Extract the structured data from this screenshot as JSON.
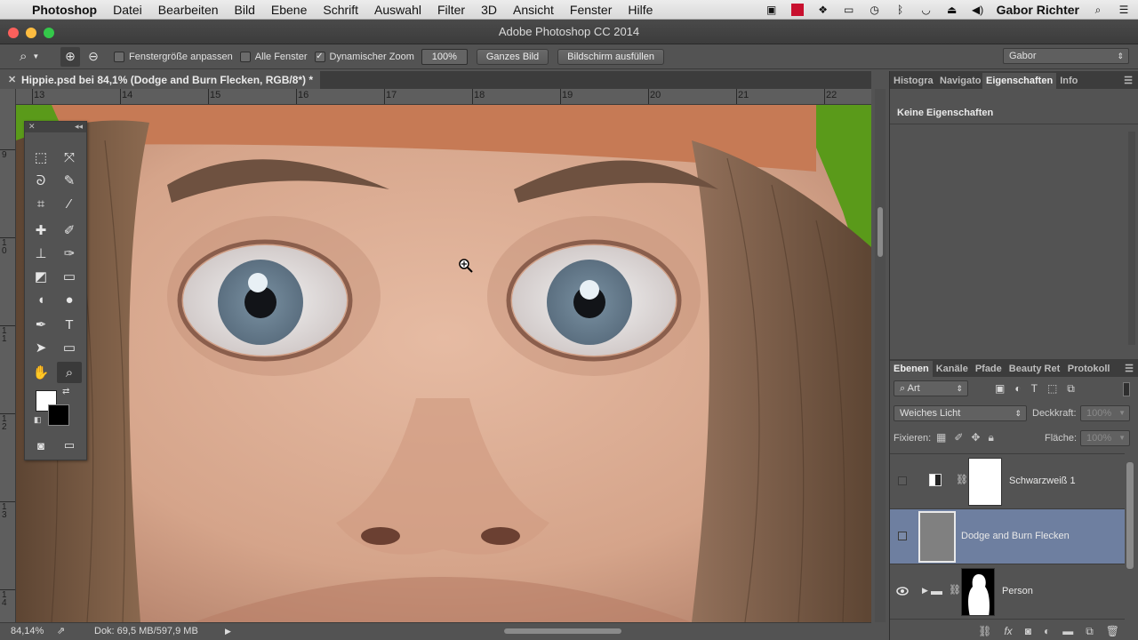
{
  "menubar": {
    "app_name": "Photoshop",
    "items": [
      "Datei",
      "Bearbeiten",
      "Bild",
      "Ebene",
      "Schrift",
      "Auswahl",
      "Filter",
      "3D",
      "Ansicht",
      "Fenster",
      "Hilfe"
    ],
    "user": "Gabor Richter"
  },
  "window": {
    "title": "Adobe Photoshop CC 2014"
  },
  "options_bar": {
    "resize_label": "Fenstergröße anpassen",
    "all_windows_label": "Alle Fenster",
    "scrubby_zoom_label": "Dynamischer Zoom",
    "zoom_value": "100%",
    "fit_screen_label": "Ganzes Bild",
    "fill_screen_label": "Bildschirm ausfüllen",
    "workspace": "Gabor"
  },
  "document": {
    "tab_title": "Hippie.psd bei 84,1% (Dodge and Burn Flecken, RGB/8*) *",
    "ruler_h": [
      "13",
      "14",
      "15",
      "16",
      "17",
      "18",
      "19",
      "20",
      "21",
      "22"
    ],
    "ruler_v": [
      "9",
      "1 0",
      "1 1",
      "1 2",
      "1 3",
      "1 4"
    ]
  },
  "status_bar": {
    "zoom": "84,14%",
    "doc_info": "Dok: 69,5 MB/597,9 MB"
  },
  "properties_panel": {
    "tabs": [
      "Histogra",
      "Navigato",
      "Eigenschaften",
      "Info"
    ],
    "content": "Keine Eigenschaften"
  },
  "layers_panel": {
    "tabs": [
      "Ebenen",
      "Kanäle",
      "Pfade",
      "Beauty Ret",
      "Protokoll"
    ],
    "filter_kind": "Art",
    "blend_mode": "Weiches Licht",
    "opacity_label": "Deckkraft:",
    "opacity_value": "100%",
    "lock_label": "Fixieren:",
    "fill_label": "Fläche:",
    "fill_value": "100%",
    "layers": [
      {
        "name": "Schwarzweiß 1",
        "visible": false,
        "selected": false
      },
      {
        "name": "Dodge and Burn Flecken",
        "visible": false,
        "selected": true
      },
      {
        "name": "Person",
        "visible": true,
        "selected": false
      }
    ]
  },
  "colors": {
    "panel_bg": "#535353",
    "selected_layer": "#6e7fa0",
    "skin": "#d8a98f",
    "hair": "#7a5a44",
    "green_screen": "#5a9a1a"
  }
}
